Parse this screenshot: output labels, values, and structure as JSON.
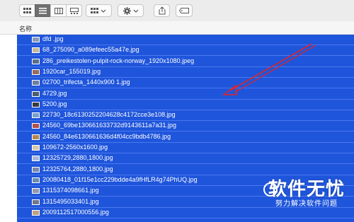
{
  "column_header": {
    "name": "名称"
  },
  "files": [
    "dfd .jpg",
    "68_275090_a089efeec55a47e.jpg",
    "286_preikestolen-pulpit-rock-norway_1920x1080.jpeg",
    "1920car_155019.jpg",
    "02700_trifecta_1440x900 1.jpg",
    "4729.jpg",
    "5200.jpg",
    "22730_18c6130252204628c4172cce3e108.jpg",
    "24560_69be130661633732d9143611a7a31.jpg",
    "24560_84e6130661636d4f04cc9bdb4786.jpg",
    "109672-2560x1600.jpg",
    "12325729,2880,1800.jpg",
    "12325764,2880,1800.jpg",
    "20080418_01f15e1cc229bdde4a9fHfLR4g74PhUQ.jpg",
    "1315374098661.jpg",
    "1315495033401.jpg",
    "2009112517000556.jpg"
  ],
  "watermark": {
    "title": "软件无忧",
    "subtitle": "努力解决软件问题"
  },
  "colors": {
    "selection": "#1f55db",
    "toolbar": "#ececec",
    "arrow": "#e02626"
  },
  "toolbar_icons": [
    "icon-view-icon",
    "list-view-icon",
    "column-view-icon",
    "gallery-view-icon",
    "group-by-icon",
    "action-gear-icon",
    "share-icon",
    "tag-icon"
  ]
}
